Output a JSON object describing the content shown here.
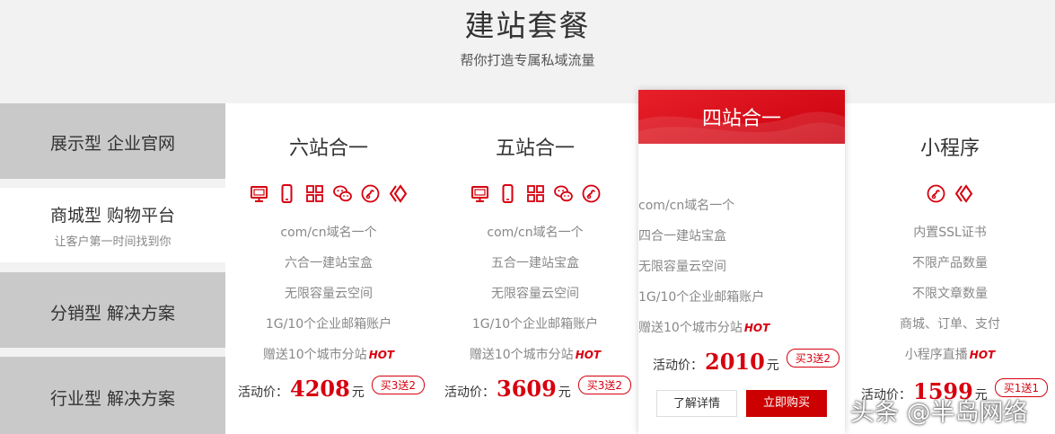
{
  "header": {
    "title": "建站套餐",
    "subtitle": "帮你打造专属私域流量"
  },
  "sidebar": {
    "items": [
      {
        "label": "展示型 企业官网",
        "sub": ""
      },
      {
        "label": "商城型 购物平台",
        "sub": "让客户第一时间找到你"
      },
      {
        "label": "分销型 解决方案",
        "sub": ""
      },
      {
        "label": "行业型 解决方案",
        "sub": ""
      }
    ]
  },
  "plans": [
    {
      "name": "六站合一",
      "icons": [
        "monitor-icon",
        "phone-icon",
        "grid-icon",
        "wechat-icon",
        "weibo-icon",
        "diamond-icon"
      ],
      "features": [
        "com/cn域名一个",
        "六合一建站宝盒",
        "无限容量云空间",
        "1G/10个企业邮箱账户",
        "赠送10个城市分站"
      ],
      "hot": "HOT",
      "price_label": "活动价：",
      "price": "4208",
      "unit": "元",
      "promo": "买3送2"
    },
    {
      "name": "五站合一",
      "icons": [
        "monitor-icon",
        "phone-icon",
        "grid-icon",
        "wechat-icon",
        "weibo-icon"
      ],
      "features": [
        "com/cn域名一个",
        "五合一建站宝盒",
        "无限容量云空间",
        "1G/10个企业邮箱账户",
        "赠送10个城市分站"
      ],
      "hot": "HOT",
      "price_label": "活动价：",
      "price": "3609",
      "unit": "元",
      "promo": "买3送2"
    },
    {
      "name": "四站合一",
      "icons": [
        "monitor-icon",
        "phone-icon",
        "grid-icon",
        "wechat-icon"
      ],
      "features": [
        "com/cn域名一个",
        "四合一建站宝盒",
        "无限容量云空间",
        "1G/10个企业邮箱账户",
        "赠送10个城市分站"
      ],
      "hot": "HOT",
      "price_label": "活动价：",
      "price": "2010",
      "unit": "元",
      "promo": "买3送2",
      "detail_label": "了解详情",
      "buy_label": "立即购买"
    },
    {
      "name": "小程序",
      "icons": [
        "weibo-icon",
        "diamond-icon"
      ],
      "features": [
        "内置SSL证书",
        "不限产品数量",
        "不限文章数量",
        "商城、订单、支付",
        "小程序直播"
      ],
      "hot": "HOT",
      "price_label": "活动价：",
      "price": "1599",
      "unit": "元",
      "promo": "买1送1"
    }
  ],
  "watermark": "头条 @半岛网络",
  "colors": {
    "accent": "#d6000f",
    "sidebar_bg": "#c9c9c9",
    "page_bg": "#f2f2f2"
  }
}
